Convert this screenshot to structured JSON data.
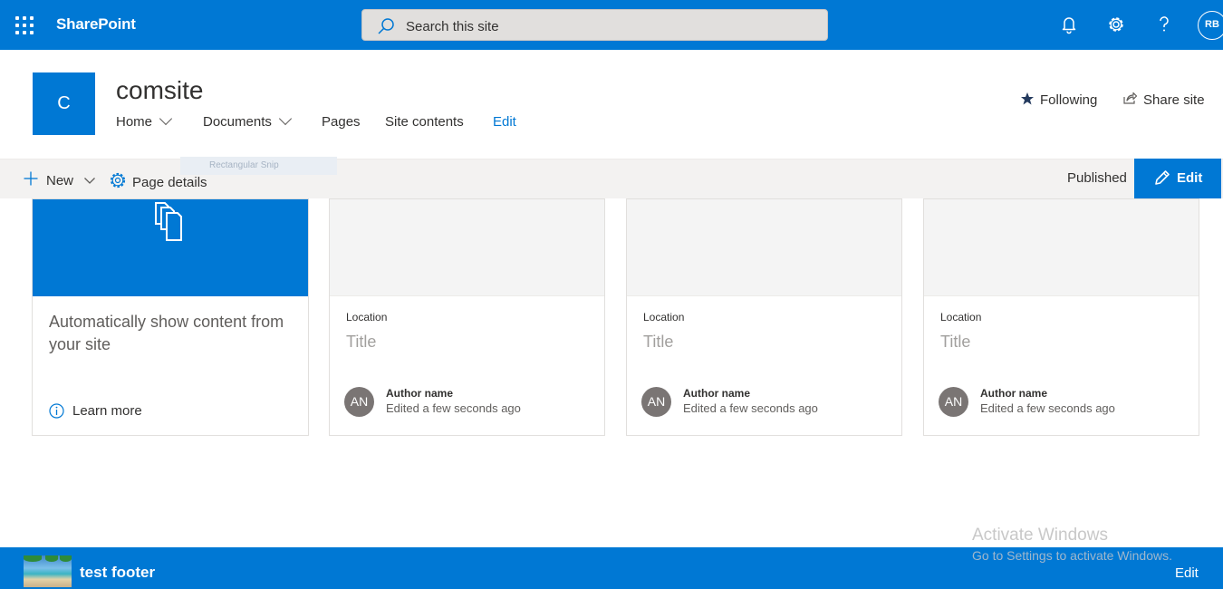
{
  "suite_bar": {
    "brand": "SharePoint",
    "search_placeholder": "Search this site",
    "avatar_initials": "RB",
    "accent_color": "#0078d4"
  },
  "site": {
    "logo_letter": "C",
    "title": "comsite",
    "nav": [
      {
        "label": "Home",
        "has_menu": true
      },
      {
        "label": "Documents",
        "has_menu": true
      },
      {
        "label": "Pages",
        "has_menu": false
      },
      {
        "label": "Site contents",
        "has_menu": false
      },
      {
        "label": "Edit",
        "has_menu": false
      }
    ],
    "following_label": "Following",
    "share_label": "Share site"
  },
  "snip_tooltip": "Rectangular Snip",
  "command_bar": {
    "new_label": "New",
    "page_details_label": "Page details",
    "status": "Published",
    "edit_label": "Edit"
  },
  "highlights": {
    "info_card": {
      "text": "Automatically show content from your site",
      "learn_more": "Learn more"
    },
    "cards": [
      {
        "location": "Location",
        "title": "Title",
        "initials": "AN",
        "author": "Author name",
        "edited": "Edited a few seconds ago"
      },
      {
        "location": "Location",
        "title": "Title",
        "initials": "AN",
        "author": "Author name",
        "edited": "Edited a few seconds ago"
      },
      {
        "location": "Location",
        "title": "Title",
        "initials": "AN",
        "author": "Author name",
        "edited": "Edited a few seconds ago"
      }
    ]
  },
  "watermark": {
    "line1": "Activate Windows",
    "line2": "Go to Settings to activate Windows."
  },
  "footer": {
    "text": "test footer",
    "edit_label": "Edit"
  }
}
